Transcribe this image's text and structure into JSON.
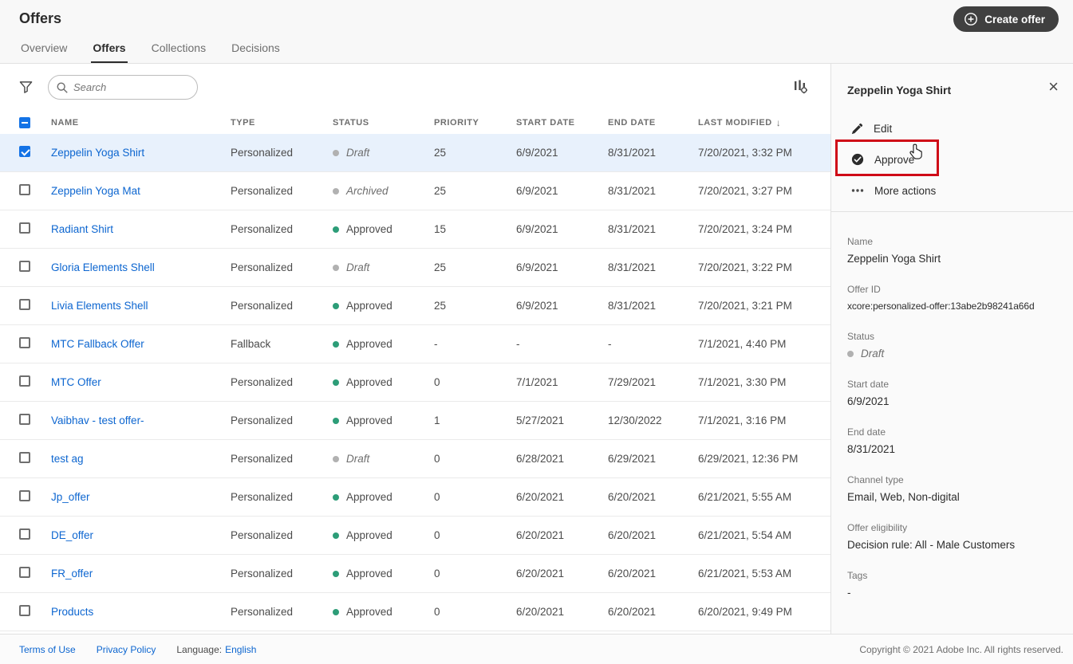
{
  "colors": {
    "accent_blue": "#1473e6",
    "link_blue": "#0d66d0",
    "approved_green": "#2d9d78",
    "neutral_dot_gray": "#b1b1b1",
    "annotation_red": "#cf0b17",
    "button_dark": "#404040"
  },
  "header": {
    "title": "Offers",
    "create_button_label": "Create offer",
    "tabs": [
      {
        "label": "Overview",
        "active": false
      },
      {
        "label": "Offers",
        "active": true
      },
      {
        "label": "Collections",
        "active": false
      },
      {
        "label": "Decisions",
        "active": false
      }
    ]
  },
  "toolbar": {
    "search_placeholder": "Search"
  },
  "icons": {
    "sort_desc": "↓",
    "close": "×"
  },
  "table": {
    "columns": [
      "NAME",
      "TYPE",
      "STATUS",
      "PRIORITY",
      "START DATE",
      "END DATE",
      "LAST MODIFIED"
    ],
    "sort_column": "LAST MODIFIED",
    "sort_direction": "desc",
    "rows": [
      {
        "name": "Zeppelin Yoga Shirt",
        "type": "Personalized",
        "status": "Draft",
        "status_kind": "draft",
        "priority": "25",
        "start_date": "6/9/2021",
        "end_date": "8/31/2021",
        "last_modified": "7/20/2021, 3:32 PM",
        "selected": true
      },
      {
        "name": "Zeppelin Yoga Mat",
        "type": "Personalized",
        "status": "Archived",
        "status_kind": "archived",
        "priority": "25",
        "start_date": "6/9/2021",
        "end_date": "8/31/2021",
        "last_modified": "7/20/2021, 3:27 PM",
        "selected": false
      },
      {
        "name": "Radiant Shirt",
        "type": "Personalized",
        "status": "Approved",
        "status_kind": "approved",
        "priority": "15",
        "start_date": "6/9/2021",
        "end_date": "8/31/2021",
        "last_modified": "7/20/2021, 3:24 PM",
        "selected": false
      },
      {
        "name": "Gloria Elements Shell",
        "type": "Personalized",
        "status": "Draft",
        "status_kind": "draft",
        "priority": "25",
        "start_date": "6/9/2021",
        "end_date": "8/31/2021",
        "last_modified": "7/20/2021, 3:22 PM",
        "selected": false
      },
      {
        "name": "Livia Elements Shell",
        "type": "Personalized",
        "status": "Approved",
        "status_kind": "approved",
        "priority": "25",
        "start_date": "6/9/2021",
        "end_date": "8/31/2021",
        "last_modified": "7/20/2021, 3:21 PM",
        "selected": false
      },
      {
        "name": "MTC Fallback Offer",
        "type": "Fallback",
        "status": "Approved",
        "status_kind": "approved",
        "priority": "-",
        "start_date": "-",
        "end_date": "-",
        "last_modified": "7/1/2021, 4:40 PM",
        "selected": false
      },
      {
        "name": "MTC Offer",
        "type": "Personalized",
        "status": "Approved",
        "status_kind": "approved",
        "priority": "0",
        "start_date": "7/1/2021",
        "end_date": "7/29/2021",
        "last_modified": "7/1/2021, 3:30 PM",
        "selected": false
      },
      {
        "name": "Vaibhav - test offer-",
        "type": "Personalized",
        "status": "Approved",
        "status_kind": "approved",
        "priority": "1",
        "start_date": "5/27/2021",
        "end_date": "12/30/2022",
        "last_modified": "7/1/2021, 3:16 PM",
        "selected": false
      },
      {
        "name": "test ag",
        "type": "Personalized",
        "status": "Draft",
        "status_kind": "draft",
        "priority": "0",
        "start_date": "6/28/2021",
        "end_date": "6/29/2021",
        "last_modified": "6/29/2021, 12:36 PM",
        "selected": false
      },
      {
        "name": "Jp_offer",
        "type": "Personalized",
        "status": "Approved",
        "status_kind": "approved",
        "priority": "0",
        "start_date": "6/20/2021",
        "end_date": "6/20/2021",
        "last_modified": "6/21/2021, 5:55 AM",
        "selected": false
      },
      {
        "name": "DE_offer",
        "type": "Personalized",
        "status": "Approved",
        "status_kind": "approved",
        "priority": "0",
        "start_date": "6/20/2021",
        "end_date": "6/20/2021",
        "last_modified": "6/21/2021, 5:54 AM",
        "selected": false
      },
      {
        "name": "FR_offer",
        "type": "Personalized",
        "status": "Approved",
        "status_kind": "approved",
        "priority": "0",
        "start_date": "6/20/2021",
        "end_date": "6/20/2021",
        "last_modified": "6/21/2021, 5:53 AM",
        "selected": false
      },
      {
        "name": "Products",
        "type": "Personalized",
        "status": "Approved",
        "status_kind": "approved",
        "priority": "0",
        "start_date": "6/20/2021",
        "end_date": "6/20/2021",
        "last_modified": "6/20/2021, 9:49 PM",
        "selected": false
      }
    ]
  },
  "panel": {
    "title": "Zeppelin Yoga Shirt",
    "actions": [
      {
        "label": "Edit",
        "highlighted": false
      },
      {
        "label": "Approve",
        "highlighted": true
      },
      {
        "label": "More actions",
        "highlighted": false
      }
    ],
    "fields": [
      {
        "label": "Name",
        "value": "Zeppelin Yoga Shirt"
      },
      {
        "label": "Offer ID",
        "value": "xcore:personalized-offer:13abe2b98241a66d",
        "kind": "offer-id"
      },
      {
        "label": "Status",
        "value": "Draft",
        "kind": "status"
      },
      {
        "label": "Start date",
        "value": "6/9/2021"
      },
      {
        "label": "End date",
        "value": "8/31/2021"
      },
      {
        "label": "Channel type",
        "value": "Email, Web, Non-digital"
      },
      {
        "label": "Offer eligibility",
        "value": "Decision rule: All - Male Customers"
      },
      {
        "label": "Tags",
        "value": "-"
      }
    ]
  },
  "footer": {
    "links": [
      {
        "label": "Terms of Use"
      },
      {
        "label": "Privacy Policy"
      }
    ],
    "language_label": "Language:",
    "language_value": "English",
    "copyright": "Copyright © 2021 Adobe Inc.  All rights reserved."
  }
}
